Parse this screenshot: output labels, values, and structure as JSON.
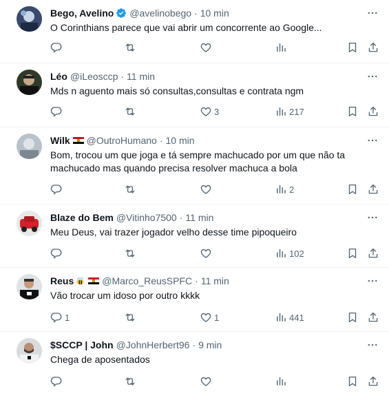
{
  "tweets": [
    {
      "name": "Bego, Avelino",
      "handle": "@avelinobego",
      "time": "10 min",
      "verified": true,
      "text": "O Corinthians parece que vai abrir um concorrente ao Google...",
      "replies": "",
      "retweets": "",
      "likes": "",
      "views": ""
    },
    {
      "name": "Léo",
      "handle": "@iLeosccp",
      "time": "11 min",
      "text": "Mds n aguento mais só consultas,consultas e contrata ngm",
      "replies": "",
      "retweets": "",
      "likes": "3",
      "views": "217"
    },
    {
      "name": "Wilk",
      "handle": "@OutroHumano",
      "time": "10 min",
      "flag": "egypt",
      "text": "Bom, trocou um que joga e tá sempre machucado por um que não ta machucado mas quando precisa resolver machuca a bola",
      "replies": "",
      "retweets": "",
      "likes": "",
      "views": "2"
    },
    {
      "name": "Blaze do Bem",
      "handle": "@Vitinho7500",
      "time": "11 min",
      "text": "Meu Deus, vai trazer jogador velho desse time pipoqueiro",
      "replies": "",
      "retweets": "",
      "likes": "",
      "views": "102"
    },
    {
      "name": "Reus",
      "handle": "@Marco_ReusSPFC",
      "time": "11 min",
      "flag": "egypt",
      "emoji": "bee",
      "text": "Vão trocar um idoso por outro kkkk",
      "replies": "1",
      "retweets": "",
      "likes": "1",
      "views": "441"
    },
    {
      "name": "$SCCP | John",
      "handle": "@JohnHerbert96",
      "time": "9 min",
      "text": "Chega de aposentados",
      "replies": "",
      "retweets": "",
      "likes": "",
      "views": ""
    }
  ],
  "separator": "·",
  "icons": {
    "verified": "verified-badge-icon",
    "more": "more-horizontal-icon",
    "reply": "reply-icon",
    "retweet": "retweet-icon",
    "like": "heart-icon",
    "views": "views-bar-chart-icon",
    "bookmark": "bookmark-icon",
    "share": "share-icon"
  },
  "colors": {
    "text": "#0f1419",
    "secondary": "#536471",
    "verified": "#1d9bf0",
    "divider": "#eff3f4"
  }
}
